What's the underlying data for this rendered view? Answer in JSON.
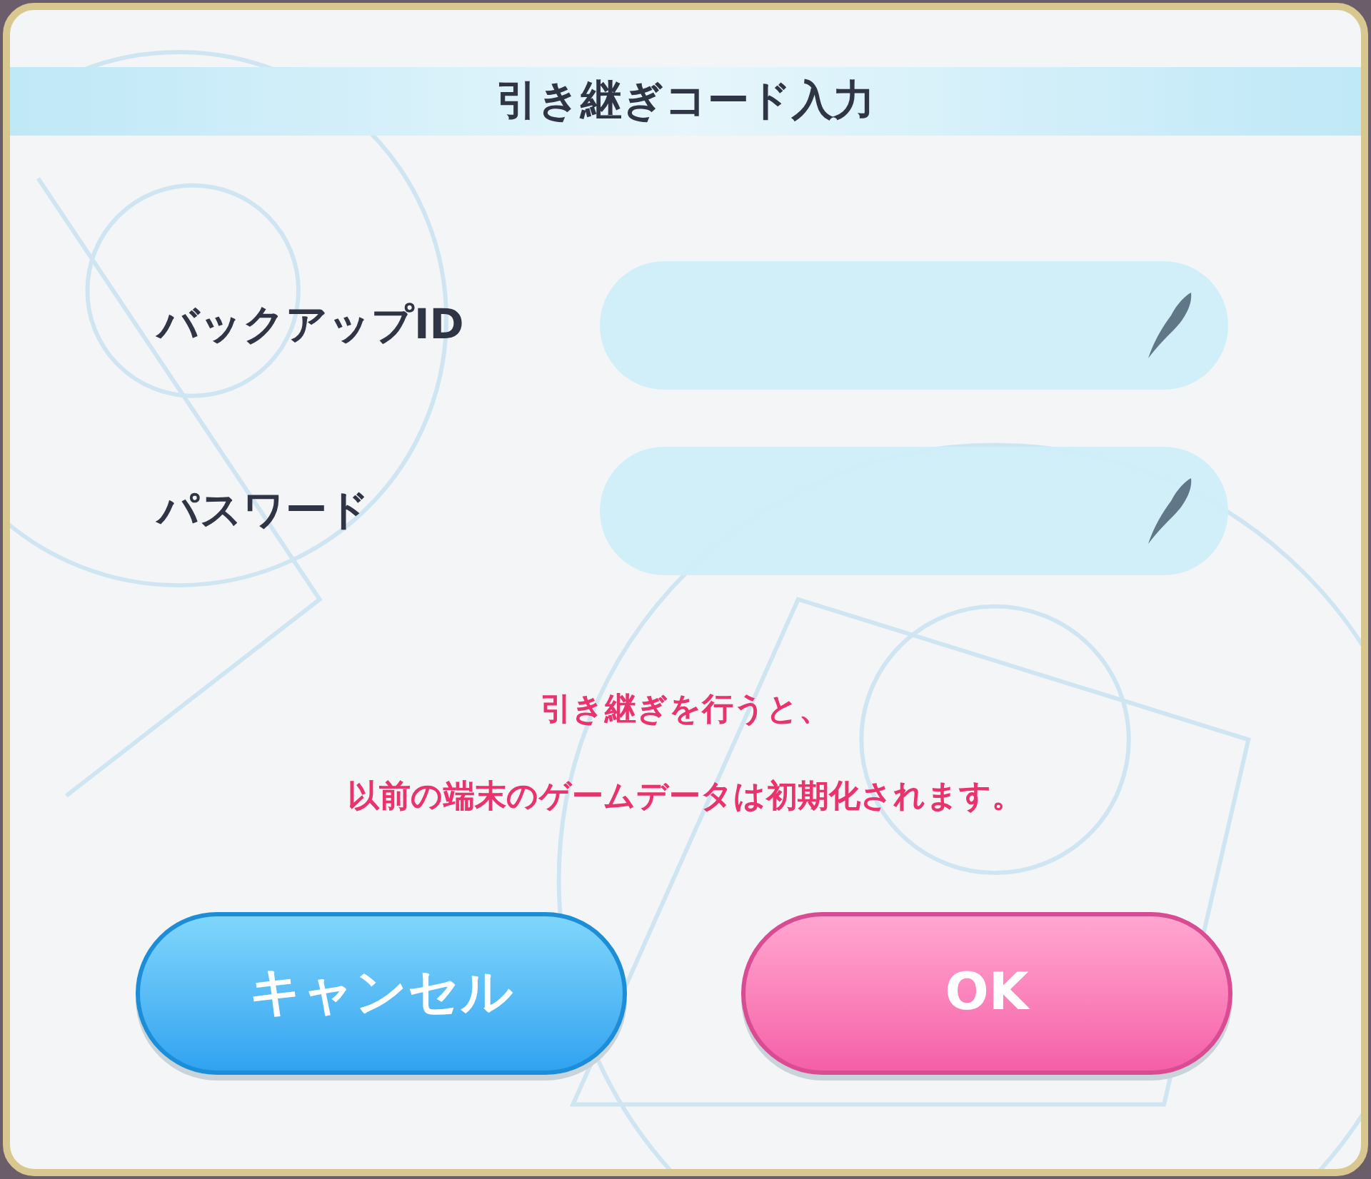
{
  "dialog": {
    "title": "引き継ぎコード入力",
    "fields": [
      {
        "label": "バックアップID"
      },
      {
        "label": "パスワード"
      }
    ],
    "notice": [
      "引き継ぎを行うと、",
      "以前の端末のゲームデータは初期化されます。"
    ],
    "buttons": [
      {
        "label": "キャンセル",
        "kind": "cancel"
      },
      {
        "label": "OK",
        "kind": "confirm"
      }
    ]
  }
}
